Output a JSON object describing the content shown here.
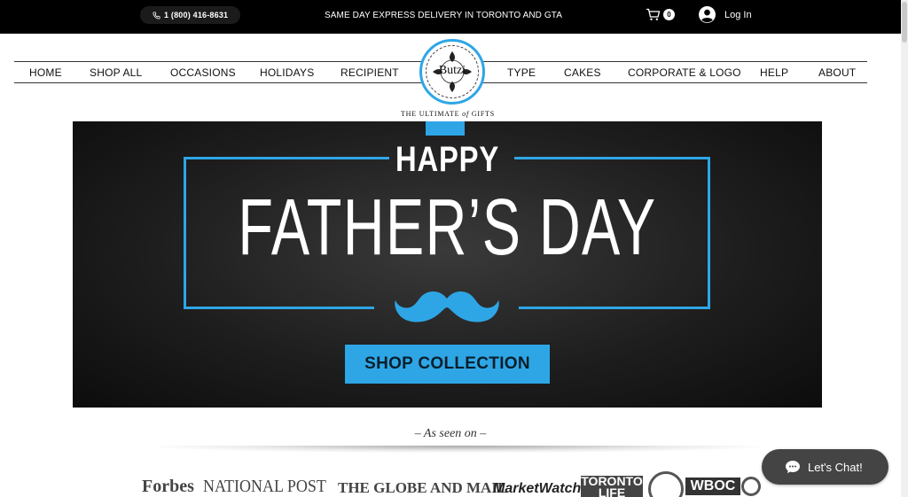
{
  "topbar": {
    "phone": "1 (800) 416-8631",
    "announcement": "SAME DAY EXPRESS DELIVERY IN TORONTO AND GTA",
    "cart_count": "0",
    "login_label": "Log In"
  },
  "nav": {
    "left": [
      "HOME",
      "SHOP ALL",
      "OCCASIONS",
      "HOLIDAYS",
      "RECIPIENT"
    ],
    "right": [
      "TYPE",
      "CAKES",
      "CORPORATE & LOGO",
      "HELP",
      "ABOUT"
    ]
  },
  "logo": {
    "text": "Butzi",
    "tagline_prefix": "THE ULTIMATE",
    "tagline_of": "of",
    "tagline_suffix": "GIFTS"
  },
  "banner": {
    "happy": "HAPPY",
    "headline": "FATHER’S DAY",
    "cta": "SHOP COLLECTION",
    "accent_color": "#2ea6e6"
  },
  "press": {
    "heading": "– As seen on –",
    "outlets": [
      "Forbes",
      "NATIONAL POST",
      "THE GLOBE AND MAIL",
      "MarketWatch",
      "TORONTO LIFE",
      "WBOC"
    ]
  },
  "chat": {
    "label": "Let's Chat!"
  }
}
